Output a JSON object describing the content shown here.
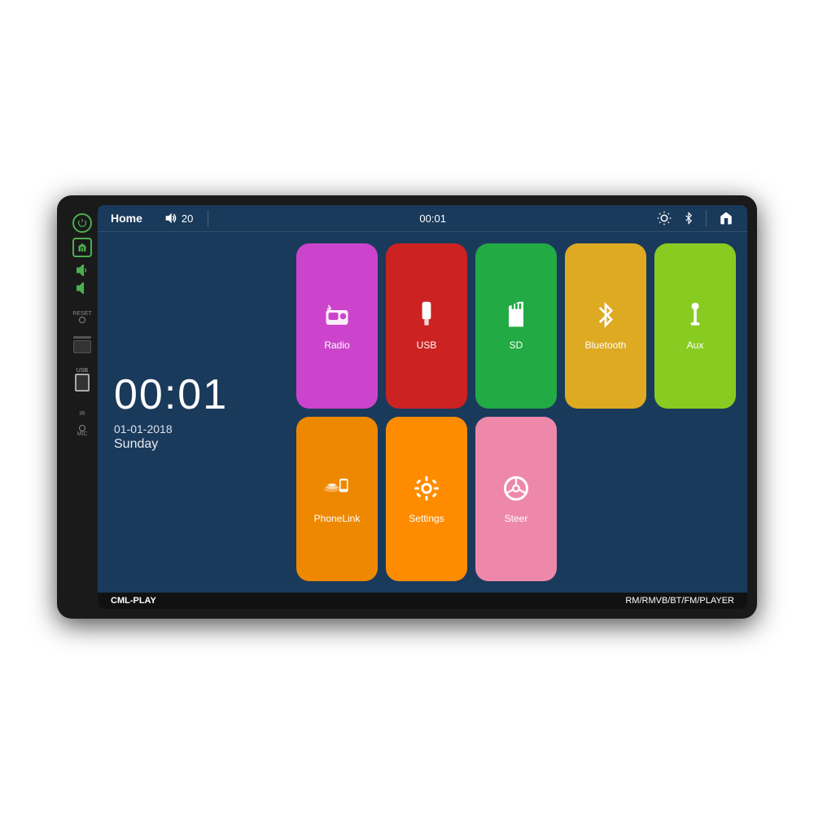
{
  "device": {
    "brand": "CML-PLAY",
    "model_info": "RM/RMVB/BT/FM/PLAYER"
  },
  "status_bar": {
    "home_label": "Home",
    "volume_icon": "🔊",
    "volume_level": "20",
    "time": "00:01",
    "brightness_icon": "☀",
    "bluetooth_icon": "⚡",
    "house_icon": "🏠"
  },
  "clock": {
    "time": "00:01",
    "date": "01-01-2018",
    "day": "Sunday"
  },
  "apps": [
    {
      "id": "radio",
      "label": "Radio",
      "color_class": "app-radio"
    },
    {
      "id": "usb",
      "label": "USB",
      "color_class": "app-usb"
    },
    {
      "id": "sd",
      "label": "SD",
      "color_class": "app-sd"
    },
    {
      "id": "bluetooth",
      "label": "Bluetooth",
      "color_class": "app-bluetooth"
    },
    {
      "id": "aux",
      "label": "Aux",
      "color_class": "app-aux"
    },
    {
      "id": "phonelink",
      "label": "PhoneLink",
      "color_class": "app-phonelink"
    },
    {
      "id": "settings",
      "label": "Settings",
      "color_class": "app-settings"
    },
    {
      "id": "steer",
      "label": "Steer",
      "color_class": "app-steer"
    }
  ],
  "left_controls": {
    "power_label": "⏻",
    "home_label": "⌂",
    "vol_up_label": "◄+",
    "vol_down_label": "◄-",
    "reset_label": "RESET",
    "usb_label": "USB",
    "ir_label": "IR",
    "mic_label": "MIC"
  }
}
